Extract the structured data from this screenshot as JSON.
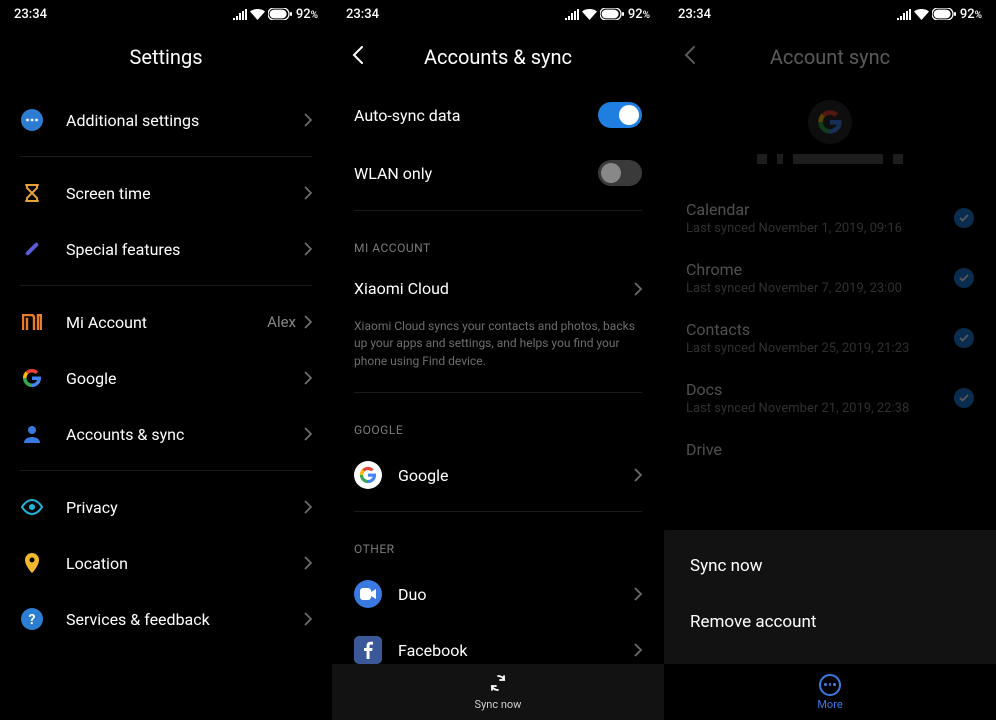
{
  "status": {
    "time": "23:34",
    "battery": "92",
    "battery_suffix": "%"
  },
  "screen1": {
    "title": "Settings",
    "items": {
      "additional": "Additional settings",
      "screen_time": "Screen time",
      "special": "Special features",
      "mi_account": "Mi Account",
      "mi_account_value": "Alex",
      "google": "Google",
      "accounts_sync": "Accounts & sync",
      "privacy": "Privacy",
      "location": "Location",
      "services": "Services & feedback"
    }
  },
  "screen2": {
    "title": "Accounts & sync",
    "toggles": {
      "auto_sync": "Auto-sync data",
      "wlan_only": "WLAN only"
    },
    "sections": {
      "mi": "MI ACCOUNT",
      "mi_cloud": "Xiaomi Cloud",
      "mi_note": "Xiaomi Cloud syncs your contacts and photos, backs up your apps and settings, and helps you find your phone using Find device.",
      "google": "GOOGLE",
      "google_item": "Google",
      "other": "OTHER",
      "duo": "Duo",
      "facebook": "Facebook"
    },
    "bottom": "Sync now"
  },
  "screen3": {
    "title": "Account sync",
    "items": [
      {
        "title": "Calendar",
        "sub": "Last synced November 1, 2019, 09:16"
      },
      {
        "title": "Chrome",
        "sub": "Last synced November 7, 2019, 23:00"
      },
      {
        "title": "Contacts",
        "sub": "Last synced November 25, 2019, 21:23"
      },
      {
        "title": "Docs",
        "sub": "Last synced November 21, 2019, 22:38"
      },
      {
        "title": "Drive",
        "sub": ""
      }
    ],
    "menu": {
      "sync_now": "Sync now",
      "remove": "Remove account"
    },
    "bottom": "More"
  }
}
